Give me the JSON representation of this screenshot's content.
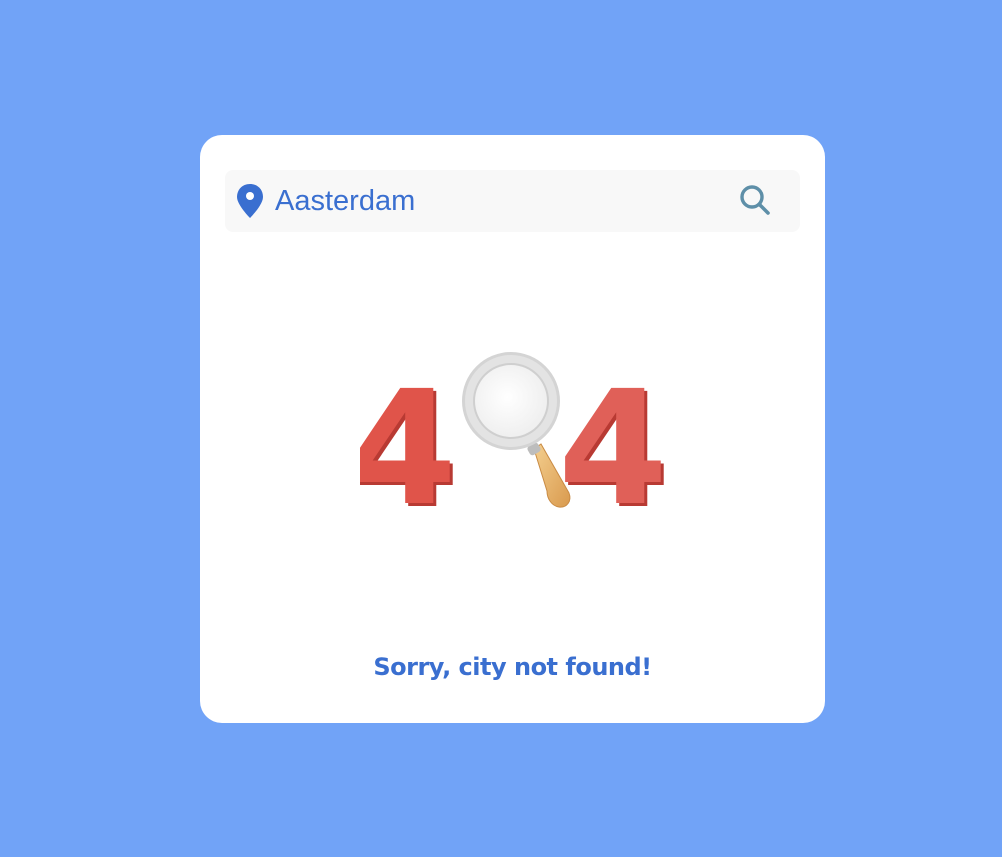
{
  "search": {
    "value": "Aasterdam",
    "location_icon": "map-pin-icon",
    "button_icon": "search-icon"
  },
  "not_found": {
    "code_left": "4",
    "code_right": "4",
    "illustration_icon": "magnifying-glass-icon",
    "message": "Sorry, city not found!"
  },
  "colors": {
    "background": "#71a3f7",
    "card": "#ffffff",
    "accent": "#3a6fd0",
    "digit_red": "#e0544a",
    "search_icon": "#5e8fa8"
  }
}
